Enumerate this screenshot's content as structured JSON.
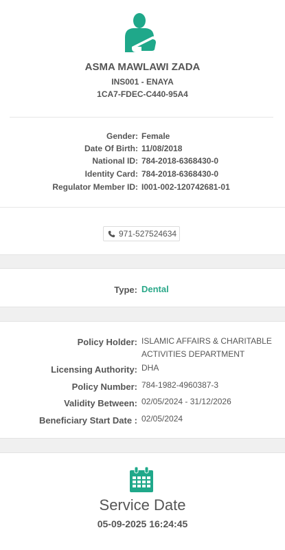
{
  "patient": {
    "name": "ASMA MAWLAWI ZADA",
    "insurer": "INS001 - ENAYA",
    "card_number": "1CA7-FDEC-C440-95A4",
    "details": [
      {
        "label": "Gender:",
        "value": "Female"
      },
      {
        "label": "Date Of Birth:",
        "value": "11/08/2018"
      },
      {
        "label": "National ID:",
        "value": "784-2018-6368430-0"
      },
      {
        "label": "Identity Card:",
        "value": "784-2018-6368430-0"
      },
      {
        "label": "Regulator Member ID:",
        "value": "I001-002-120742681-01"
      }
    ]
  },
  "contact": {
    "phone": "971-527524634",
    "phone_icon": "phone-icon"
  },
  "type": {
    "label": "Type:",
    "value": "Dental"
  },
  "policy": {
    "holder_label": "Policy Holder:",
    "holder_value_line1": "ISLAMIC AFFAIRS & CHARITABLE",
    "holder_value_line2": "ACTIVITIES DEPARTMENT",
    "authority_label": "Licensing Authority:",
    "authority_value": "DHA",
    "number_label": "Policy Number:",
    "number_value": "784-1982-4960387-3",
    "validity_label": "Validity Between:",
    "validity_value": "02/05/2024 - 31/12/2026",
    "start_label": "Beneficiary Start Date :",
    "start_value": "02/05/2024"
  },
  "service": {
    "icon": "calendar-icon",
    "title": "Service Date",
    "datetime": "05-09-2025 16:24:45"
  },
  "colors": {
    "accent": "#2aa889",
    "text": "#555555",
    "gap": "#f0f0f0"
  }
}
